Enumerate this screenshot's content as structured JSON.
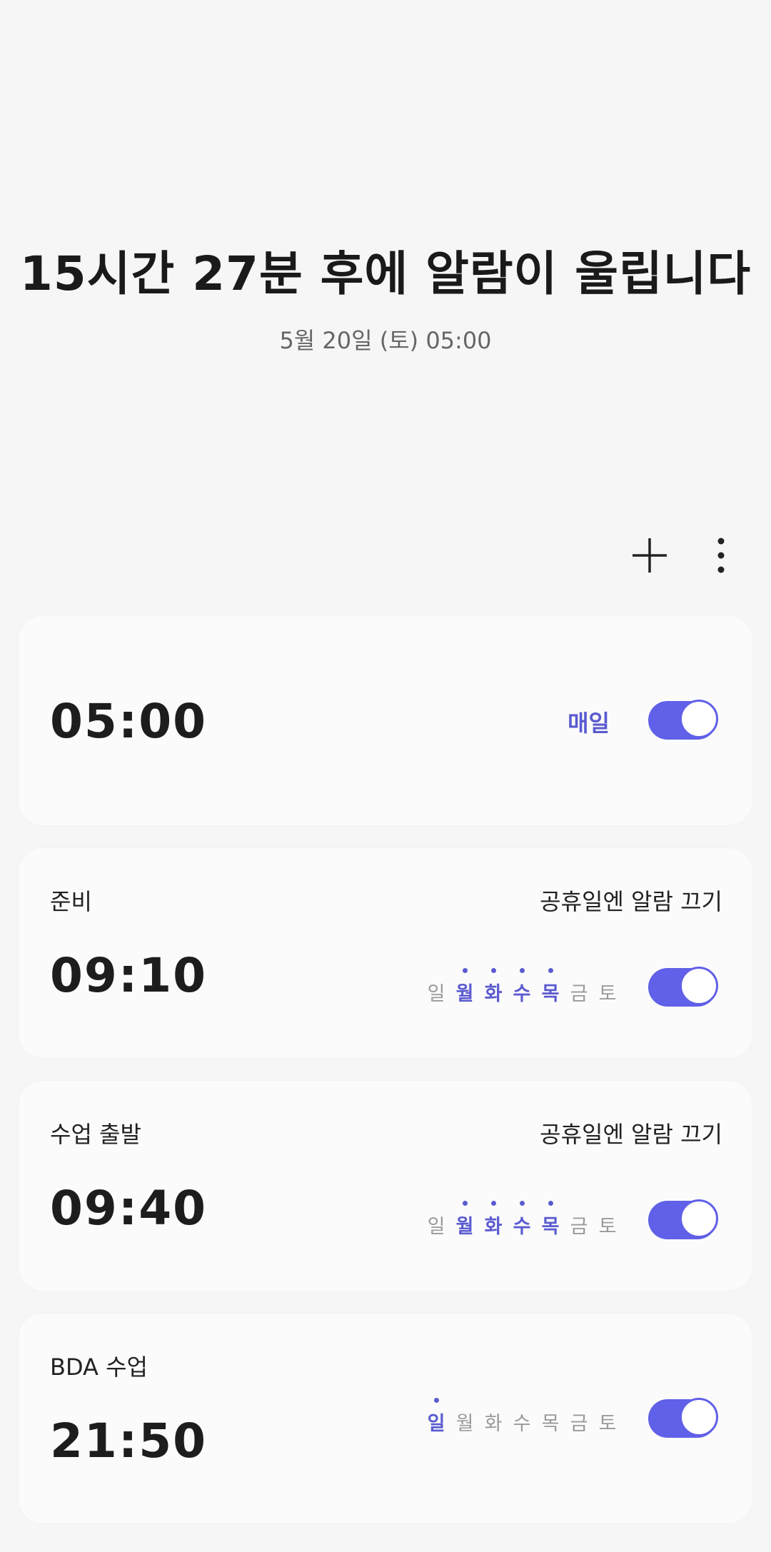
{
  "header": {
    "headline": "15시간 27분 후에 알람이 울립니다",
    "next_alarm": "5월 20일 (토) 05:00"
  },
  "toolbar": {
    "add_icon": "plus-icon",
    "more_icon": "more-vertical-icon"
  },
  "accent_color": "#6060e8",
  "alarms": [
    {
      "label": "",
      "holiday_text": "",
      "time": "05:00",
      "repeat_text": "매일",
      "enabled": true
    },
    {
      "label": "준비",
      "holiday_text": "공휴일엔 알람 끄기",
      "time": "09:10",
      "days": [
        "일",
        "월",
        "화",
        "수",
        "목",
        "금",
        "토"
      ],
      "active_days": [
        false,
        true,
        true,
        true,
        true,
        false,
        false
      ],
      "enabled": true
    },
    {
      "label": "수업 출발",
      "holiday_text": "공휴일엔 알람 끄기",
      "time": "09:40",
      "days": [
        "일",
        "월",
        "화",
        "수",
        "목",
        "금",
        "토"
      ],
      "active_days": [
        false,
        true,
        true,
        true,
        true,
        false,
        false
      ],
      "enabled": true
    },
    {
      "label": "BDA 수업",
      "holiday_text": "",
      "time": "21:50",
      "days": [
        "일",
        "월",
        "화",
        "수",
        "목",
        "금",
        "토"
      ],
      "active_days": [
        true,
        false,
        false,
        false,
        false,
        false,
        false
      ],
      "enabled": true
    }
  ]
}
